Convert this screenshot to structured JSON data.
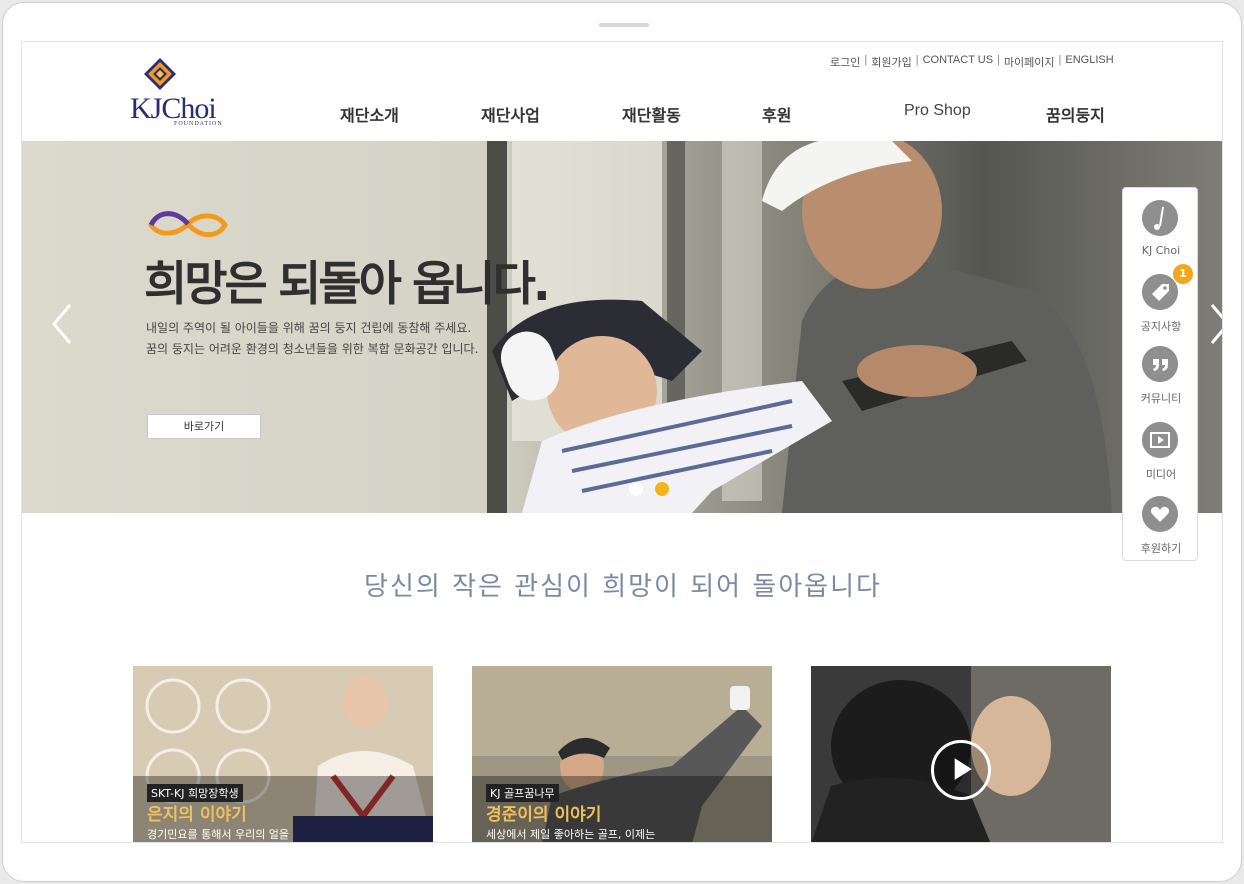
{
  "util_nav": [
    "로그인",
    "회원가입",
    "CONTACT US",
    "마이페이지",
    "ENGLISH"
  ],
  "logo": {
    "name": "KJChoi",
    "sub": "FOUNDATION"
  },
  "gnb": [
    "재단소개",
    "재단사업",
    "재단활동",
    "후원",
    "Pro Shop",
    "꿈의둥지"
  ],
  "hero": {
    "headline": "희망은 되돌아 옵니다.",
    "desc1": "내일의 주역이 될 아이들을 위해 꿈의 둥지 건립에 동참해 주세요.",
    "desc2": "꿈의 둥지는 어려운 환경의 청소년들을 위한 복합 문화공간 입니다.",
    "button": "바로가기",
    "active_slide": 2,
    "slide_count": 2
  },
  "quick_menu": [
    {
      "label": "KJ Choi",
      "icon": "golf-icon"
    },
    {
      "label": "공지사항",
      "icon": "tag-icon",
      "badge": "1"
    },
    {
      "label": "커뮤니티",
      "icon": "quote-icon"
    },
    {
      "label": "미디어",
      "icon": "film-icon"
    },
    {
      "label": "후원하기",
      "icon": "heart-icon"
    }
  ],
  "slogan": "당신의 작은 관심이 희망이 되어 돌아옵니다",
  "cards": [
    {
      "tag": "SKT-KJ 희망장학생",
      "title": "은지의 이야기",
      "desc": "경기민요를 통해서 우리의 얼을"
    },
    {
      "tag": "KJ 골프꿈나무",
      "title": "경준이의 이야기",
      "desc": "세상에서 제일 좋아하는 골프, 이제는"
    },
    {
      "tag": "",
      "title": "",
      "desc": ""
    }
  ],
  "colors": {
    "accent": "#f3b31a",
    "brand_navy": "#2b2d74",
    "slogan": "#7a8aa0"
  }
}
